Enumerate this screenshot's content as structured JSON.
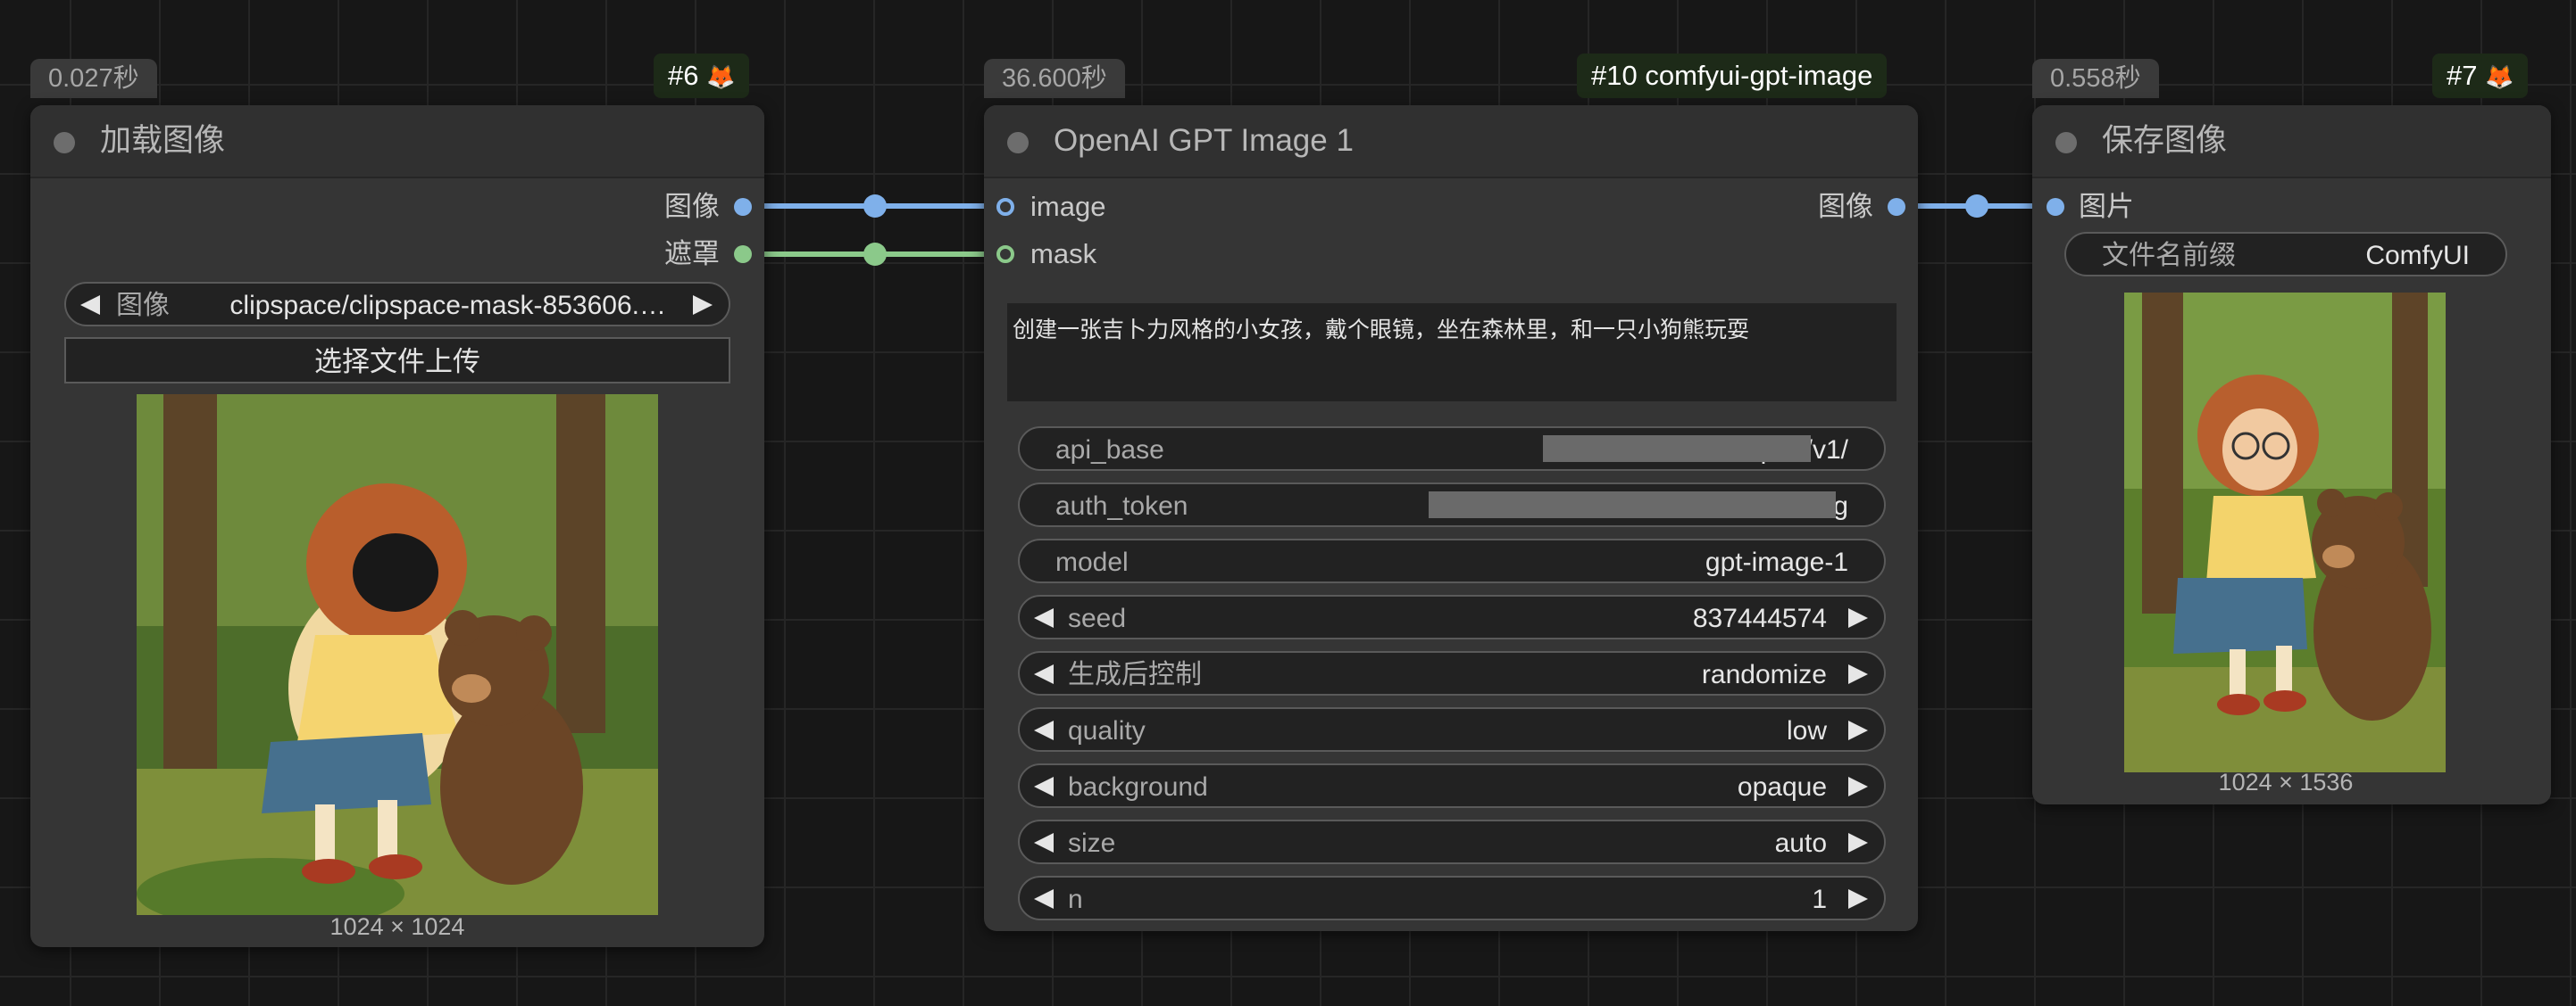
{
  "node_load": {
    "time": "0.027秒",
    "id": "#6",
    "title": "加载图像",
    "outputs": [
      "图像",
      "遮罩"
    ],
    "image_combo": {
      "label": "图像",
      "value": "clipspace/clipspace-mask-853606.…"
    },
    "upload_button": "选择文件上传",
    "caption": "1024 × 1024"
  },
  "node_gpt": {
    "time": "36.600秒",
    "id": "#10 comfyui-gpt-image",
    "title": "OpenAI GPT Image 1",
    "inputs": [
      "image",
      "mask"
    ],
    "output": "图像",
    "prompt": "创建一张吉卜力风格的小女孩，戴个眼镜，坐在森林里，和一只小狗熊玩耍",
    "widgets": [
      {
        "name": "api_base",
        "value": "http://                         /v1/"
      },
      {
        "name": "auth_token",
        "value": "sk-B                                  g"
      },
      {
        "name": "model",
        "value": "gpt-image-1"
      },
      {
        "name": "seed",
        "value": "837444574"
      },
      {
        "name": "生成后控制",
        "value": "randomize"
      },
      {
        "name": "quality",
        "value": "low"
      },
      {
        "name": "background",
        "value": "opaque"
      },
      {
        "name": "size",
        "value": "auto"
      },
      {
        "name": "n",
        "value": "1"
      }
    ]
  },
  "node_save": {
    "time": "0.558秒",
    "id": "#7",
    "title": "保存图像",
    "input": "图片",
    "prefix_widget": {
      "name": "文件名前缀",
      "value": "ComfyUI"
    },
    "caption": "1024 × 1536"
  },
  "colors": {
    "image_link": "#7fb0ea",
    "mask_link": "#8bc98a",
    "id_badge_bg": "#1d2a18"
  },
  "icons": [
    "fox-icon",
    "status-dot-icon",
    "arrow-left-icon",
    "arrow-right-icon"
  ]
}
